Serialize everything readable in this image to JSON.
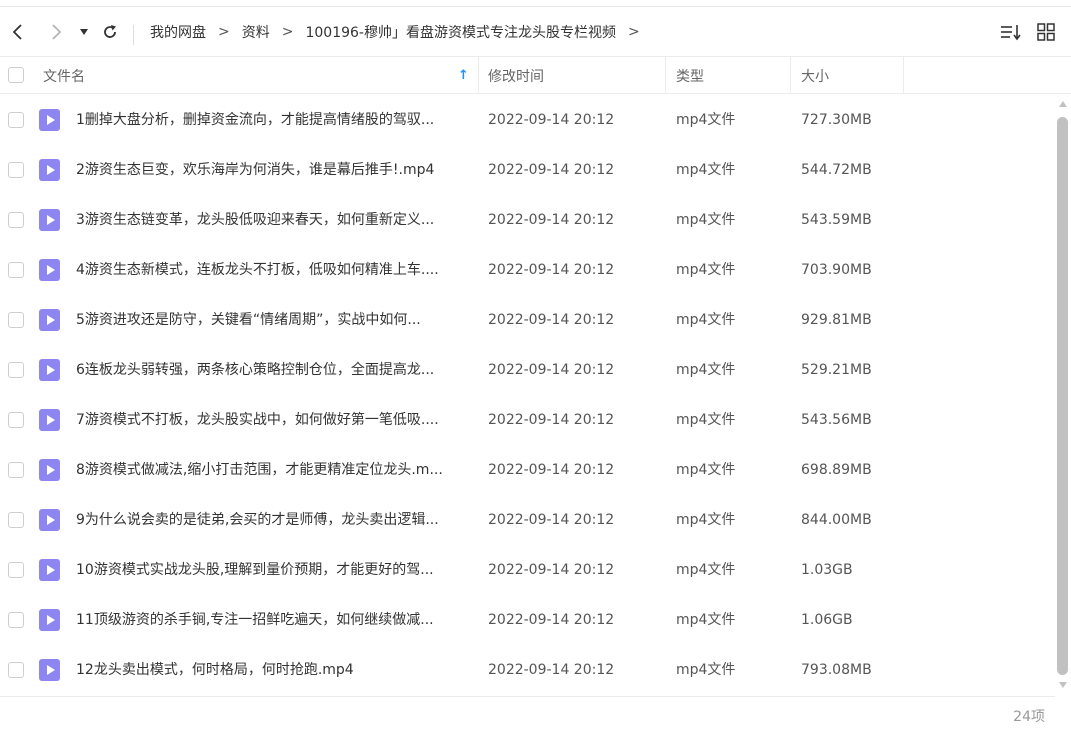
{
  "toolbar": {
    "back_icon": "chevron-left-icon",
    "forward_icon": "chevron-right-icon",
    "dropdown_icon": "caret-down-icon",
    "refresh_icon": "refresh-icon",
    "breadcrumb": [
      "我的网盘",
      "资料",
      "100196-穆帅」看盘游资模式专注龙头股专栏视频"
    ],
    "breadcrumb_separator": ">",
    "sort_icon": "sort-list-icon",
    "view_icon": "grid-view-icon"
  },
  "columns": {
    "name": "文件名",
    "modified": "修改时间",
    "type": "类型",
    "size": "大小",
    "sort_indicator": "↑"
  },
  "files": [
    {
      "name": "1删掉大盘分析，删掉资金流向，才能提高情绪股的驾驭...",
      "modified": "2022-09-14 20:12",
      "type": "mp4文件",
      "size": "727.30MB"
    },
    {
      "name": "2游资生态巨变，欢乐海岸为何消失，谁是幕后推手!.mp4",
      "modified": "2022-09-14 20:12",
      "type": "mp4文件",
      "size": "544.72MB"
    },
    {
      "name": "3游资生态链变革，龙头股低吸迎来春天，如何重新定义...",
      "modified": "2022-09-14 20:12",
      "type": "mp4文件",
      "size": "543.59MB"
    },
    {
      "name": "4游资生态新模式，连板龙头不打板，低吸如何精准上车....",
      "modified": "2022-09-14 20:12",
      "type": "mp4文件",
      "size": "703.90MB"
    },
    {
      "name": "5游资进攻还是防守，关键看“情绪周期”，实战中如何...",
      "modified": "2022-09-14 20:12",
      "type": "mp4文件",
      "size": "929.81MB"
    },
    {
      "name": "6连板龙头弱转强，两条核心策略控制仓位，全面提高龙...",
      "modified": "2022-09-14 20:12",
      "type": "mp4文件",
      "size": "529.21MB"
    },
    {
      "name": "7游资模式不打板，龙头股实战中，如何做好第一笔低吸....",
      "modified": "2022-09-14 20:12",
      "type": "mp4文件",
      "size": "543.56MB"
    },
    {
      "name": "8游资模式做减法,缩小打击范围，才能更精准定位龙头.m...",
      "modified": "2022-09-14 20:12",
      "type": "mp4文件",
      "size": "698.89MB"
    },
    {
      "name": "9为什么说会卖的是徒弟,会买的才是师傅，龙头卖出逻辑...",
      "modified": "2022-09-14 20:12",
      "type": "mp4文件",
      "size": "844.00MB"
    },
    {
      "name": "10游资模式实战龙头股,理解到量价预期，才能更好的驾...",
      "modified": "2022-09-14 20:12",
      "type": "mp4文件",
      "size": "1.03GB"
    },
    {
      "name": "11顶级游资的杀手锏,专注一招鲜吃遍天，如何继续做减...",
      "modified": "2022-09-14 20:12",
      "type": "mp4文件",
      "size": "1.06GB"
    },
    {
      "name": "12龙头卖出模式，何时格局，何时抢跑.mp4",
      "modified": "2022-09-14 20:12",
      "type": "mp4文件",
      "size": "793.08MB"
    }
  ],
  "footer": {
    "count": "24项"
  },
  "colors": {
    "video_icon": "#8e86f0",
    "sort_arrow": "#1e90ff"
  }
}
